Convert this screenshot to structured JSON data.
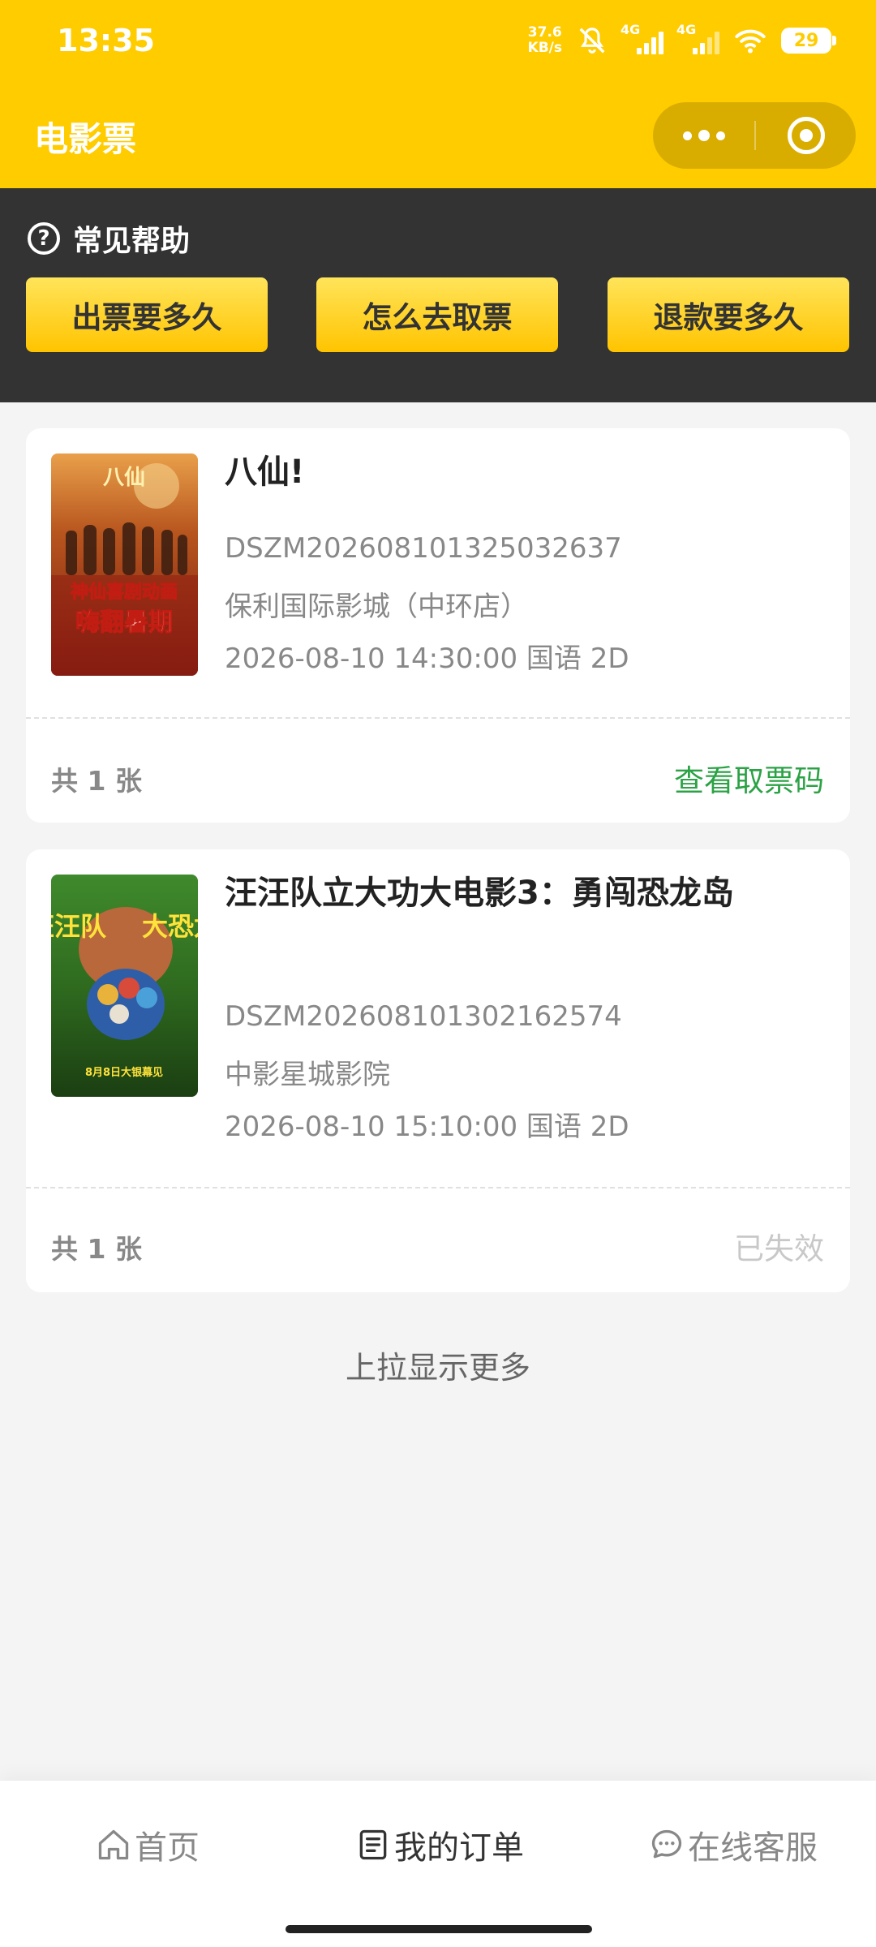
{
  "status_bar": {
    "time": "13:35",
    "net_speed_value": "37.6",
    "net_speed_unit": "KB/s",
    "sim1_label": "4G",
    "sim2_label": "4G",
    "battery_level": "29"
  },
  "nav": {
    "title": "电影票"
  },
  "help": {
    "title": "常见帮助",
    "icon_glyph": "?",
    "buttons": [
      {
        "label": "出票要多久"
      },
      {
        "label": "怎么去取票"
      },
      {
        "label": "退款要多久"
      }
    ]
  },
  "orders": [
    {
      "title": "八仙!",
      "order_no": "DSZM202608101325032637",
      "cinema": "保利国际影城（中环店）",
      "showtime": "2026-08-10 14:30:00 国语 2D",
      "count": "共 1 张",
      "action": "查看取票码",
      "action_color": "#2ba245",
      "poster": {
        "logo": "八仙",
        "line1": "神仙喜剧动画",
        "line2": "嗨翻暑期"
      }
    },
    {
      "title": "汪汪队立大功大电影3：勇闯恐龙岛",
      "order_no": "DSZM202608101302162574",
      "cinema": "中影星城影院",
      "showtime": "2026-08-10 15:10:00 国语 2D",
      "count": "共 1 张",
      "action": "已失效",
      "action_color": "#c8c8c8",
      "poster": {
        "left": "汪汪队",
        "right": "大恐龙",
        "bottom": "8月8日大银幕见"
      }
    }
  ],
  "load_more": "上拉显示更多",
  "tabbar": {
    "items": [
      {
        "label": "首页",
        "icon": "home-icon",
        "active": false
      },
      {
        "label": "我的订单",
        "icon": "order-list-icon",
        "active": true
      },
      {
        "label": "在线客服",
        "icon": "chat-bubble-icon",
        "active": false
      }
    ],
    "active_color": "#333333",
    "inactive_color": "#888888"
  },
  "colors": {
    "brand": "#ffcc00",
    "help_bg": "#333333"
  }
}
